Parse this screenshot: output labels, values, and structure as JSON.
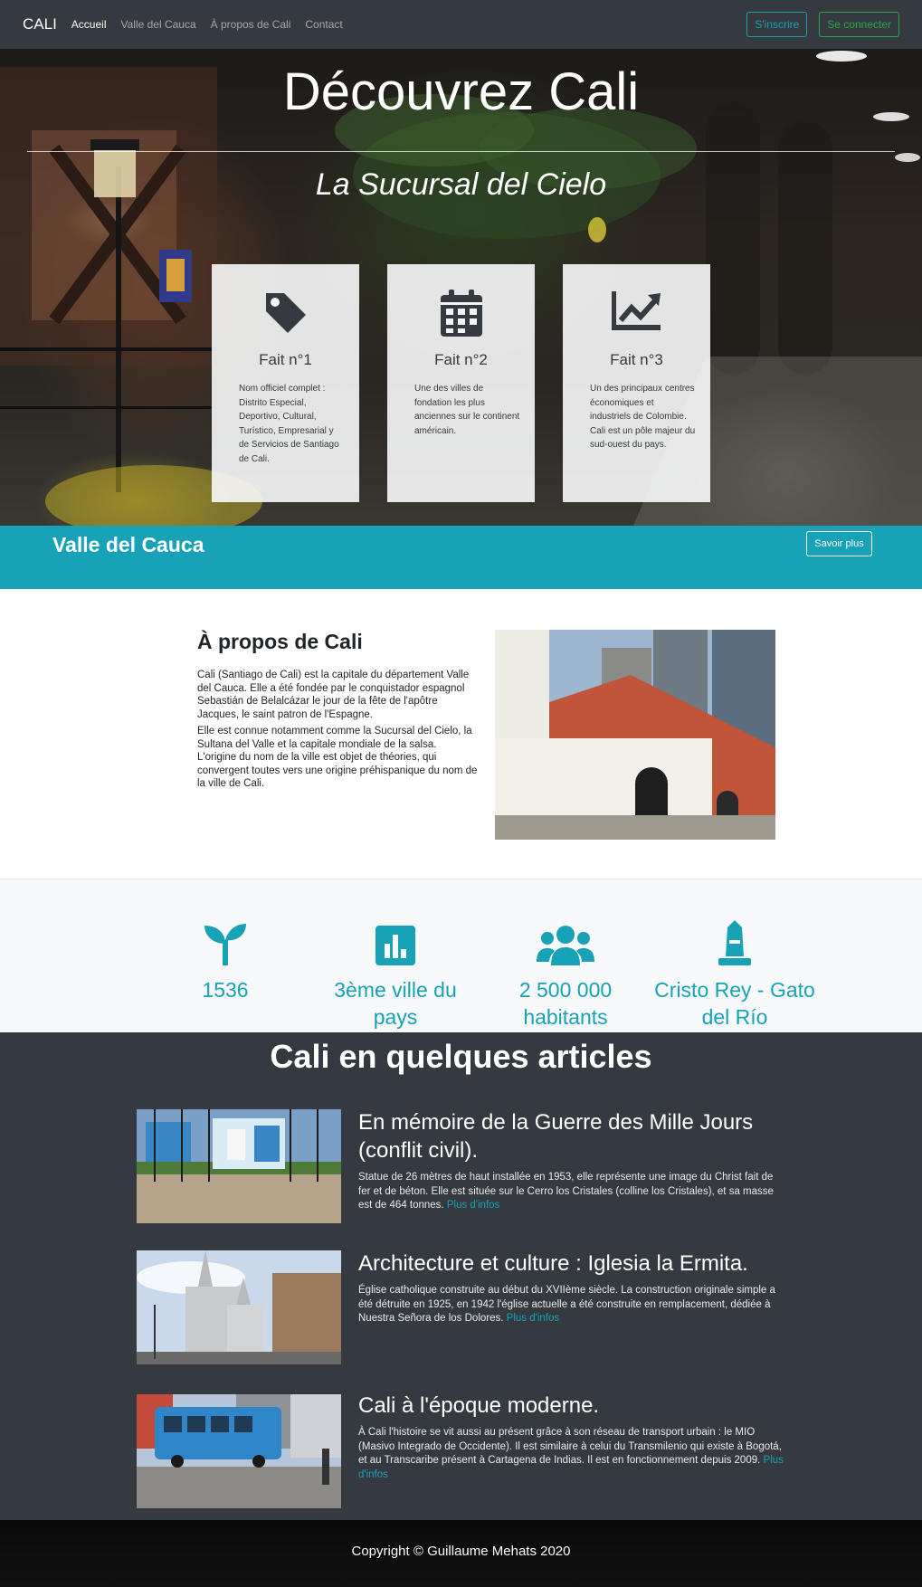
{
  "navbar": {
    "brand": "CALI",
    "links": [
      {
        "label": "Accueil",
        "active": true
      },
      {
        "label": "Valle del Cauca",
        "active": false
      },
      {
        "label": "À propos de Cali",
        "active": false
      },
      {
        "label": "Contact",
        "active": false
      }
    ],
    "signup_label": "S'inscrire",
    "login_label": "Se connecter"
  },
  "hero": {
    "title": "Découvrez Cali",
    "subtitle": "La Sucursal del Cielo",
    "facts": [
      {
        "icon": "tag-icon",
        "title": "Fait n°1",
        "text": "Nom officiel complet : Distrito Especial, Deportivo, Cultural, Turístico, Empresarial y de Servicios de Santiago de Cali."
      },
      {
        "icon": "calendar-icon",
        "title": "Fait n°2",
        "text": "Une des villes de fondation les plus anciennes sur le continent américain."
      },
      {
        "icon": "chart-line-icon",
        "title": "Fait n°3",
        "text": "Un des principaux centres économiques et industriels de Colombie. Cali est un pôle majeur du sud-ouest du pays."
      }
    ]
  },
  "valle": {
    "title": "Valle del Cauca",
    "button_label": "Savoir plus"
  },
  "about": {
    "title": "À propos de Cali",
    "paragraph1": "Cali (Santiago de Cali) est la capitale du département Valle del Cauca. Elle a été fondée par le conquistador espagnol Sebastián de Belalcázar le jour de la fête de l'apôtre Jacques, le saint patron de l'Espagne.",
    "paragraph2": "Elle est connue notamment comme la Sucursal del Cielo, la Sultana del Valle et la capitale mondiale de la salsa. L'origine du nom de la ville est objet de théories, qui convergent toutes vers une origine préhispanique du nom de la ville de Cali."
  },
  "stats": [
    {
      "icon": "seedling-icon",
      "label": "1536"
    },
    {
      "icon": "chart-bar-icon",
      "label": "3ème ville du pays"
    },
    {
      "icon": "users-icon",
      "label": "2 500 000 habitants"
    },
    {
      "icon": "monument-icon",
      "label": "Cristo Rey - Gato del Río"
    }
  ],
  "articles": {
    "title": "Cali en quelques articles",
    "items": [
      {
        "title": "En mémoire de la Guerre des Mille Jours (conflit civil).",
        "text": "Statue de 26 mètres de haut installée en 1953, elle représente une image du Christ fait de fer et de béton. Elle est située sur le Cerro los Cristales (colline los Cristales), et sa masse est de 464 tonnes.",
        "link": "Plus d'infos"
      },
      {
        "title": "Architecture et culture : Iglesia la Ermita.",
        "text": "Église catholique construite au début du XVIIème siècle. La construction originale simple a été détruite en 1925, en 1942 l'église actuelle a été construite en remplacement, dédiée à Nuestra Señora de los Dolores.",
        "link": "Plus d'infos"
      },
      {
        "title": "Cali à l'époque moderne.",
        "text": "À Cali l'histoire se vit aussi au présent grâce à son réseau de transport urbain : le MIO (Masivo Integrado de Occidente). Il est similaire à celui du Transmilenio qui existe à Bogotá, et au Transcaribe présent à Cartagena de Indias. Il est en fonctionnement depuis 2009.",
        "link": "Plus d'infos"
      }
    ]
  },
  "footer": {
    "copyright": "Copyright © Guillaume Mehats 2020"
  },
  "colors": {
    "navbar_bg": "#343a40",
    "accent_info": "#17a2b8",
    "accent_success": "#28a745",
    "stats_bg": "#f8f9fa"
  }
}
